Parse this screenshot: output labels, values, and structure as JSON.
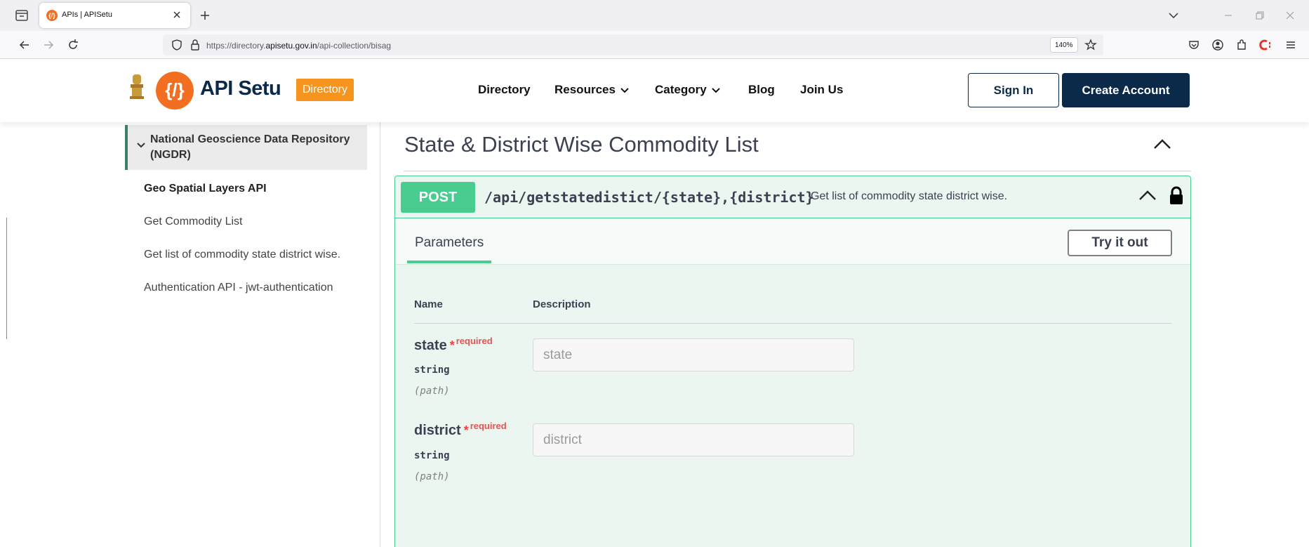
{
  "browser": {
    "tab_title": "APIs | APISetu",
    "favicon_text": "{/}",
    "url_prefix": "https://directory.",
    "url_domain": "apisetu.gov.in",
    "url_path": "/api-collection/bisag",
    "zoom": "140%"
  },
  "header": {
    "logo_text": "API Setu",
    "logo_mark": "{/}",
    "badge": "Directory",
    "menu": {
      "directory": "Directory",
      "resources": "Resources",
      "category": "Category",
      "blog": "Blog",
      "join": "Join Us"
    },
    "sign_in": "Sign In",
    "create_account": "Create Account"
  },
  "sidebar": {
    "section": "National Geoscience Data Repository (NGDR)",
    "items": [
      "Geo Spatial Layers API",
      "Get Commodity List",
      "Get list of commodity state district wise.",
      "Authentication API - jwt-authentication"
    ]
  },
  "main": {
    "title": "State & District Wise Commodity List",
    "operation": {
      "method": "POST",
      "path": "/api/getstatedistict/{state},{district}",
      "description": "Get list of commodity state district wise."
    },
    "parameters_tab": "Parameters",
    "try_button": "Try it out",
    "columns": {
      "name": "Name",
      "description": "Description"
    },
    "params": [
      {
        "name": "state",
        "star": "*",
        "required": "required",
        "type": "string",
        "in": "(path)",
        "placeholder": "state"
      },
      {
        "name": "district",
        "star": "*",
        "required": "required",
        "type": "string",
        "in": "(path)",
        "placeholder": "district"
      }
    ]
  },
  "colors": {
    "post_green": "#49cc90",
    "brand_orange": "#f26f21",
    "brand_navy": "#0b2a4a",
    "required_red": "#e55353"
  }
}
